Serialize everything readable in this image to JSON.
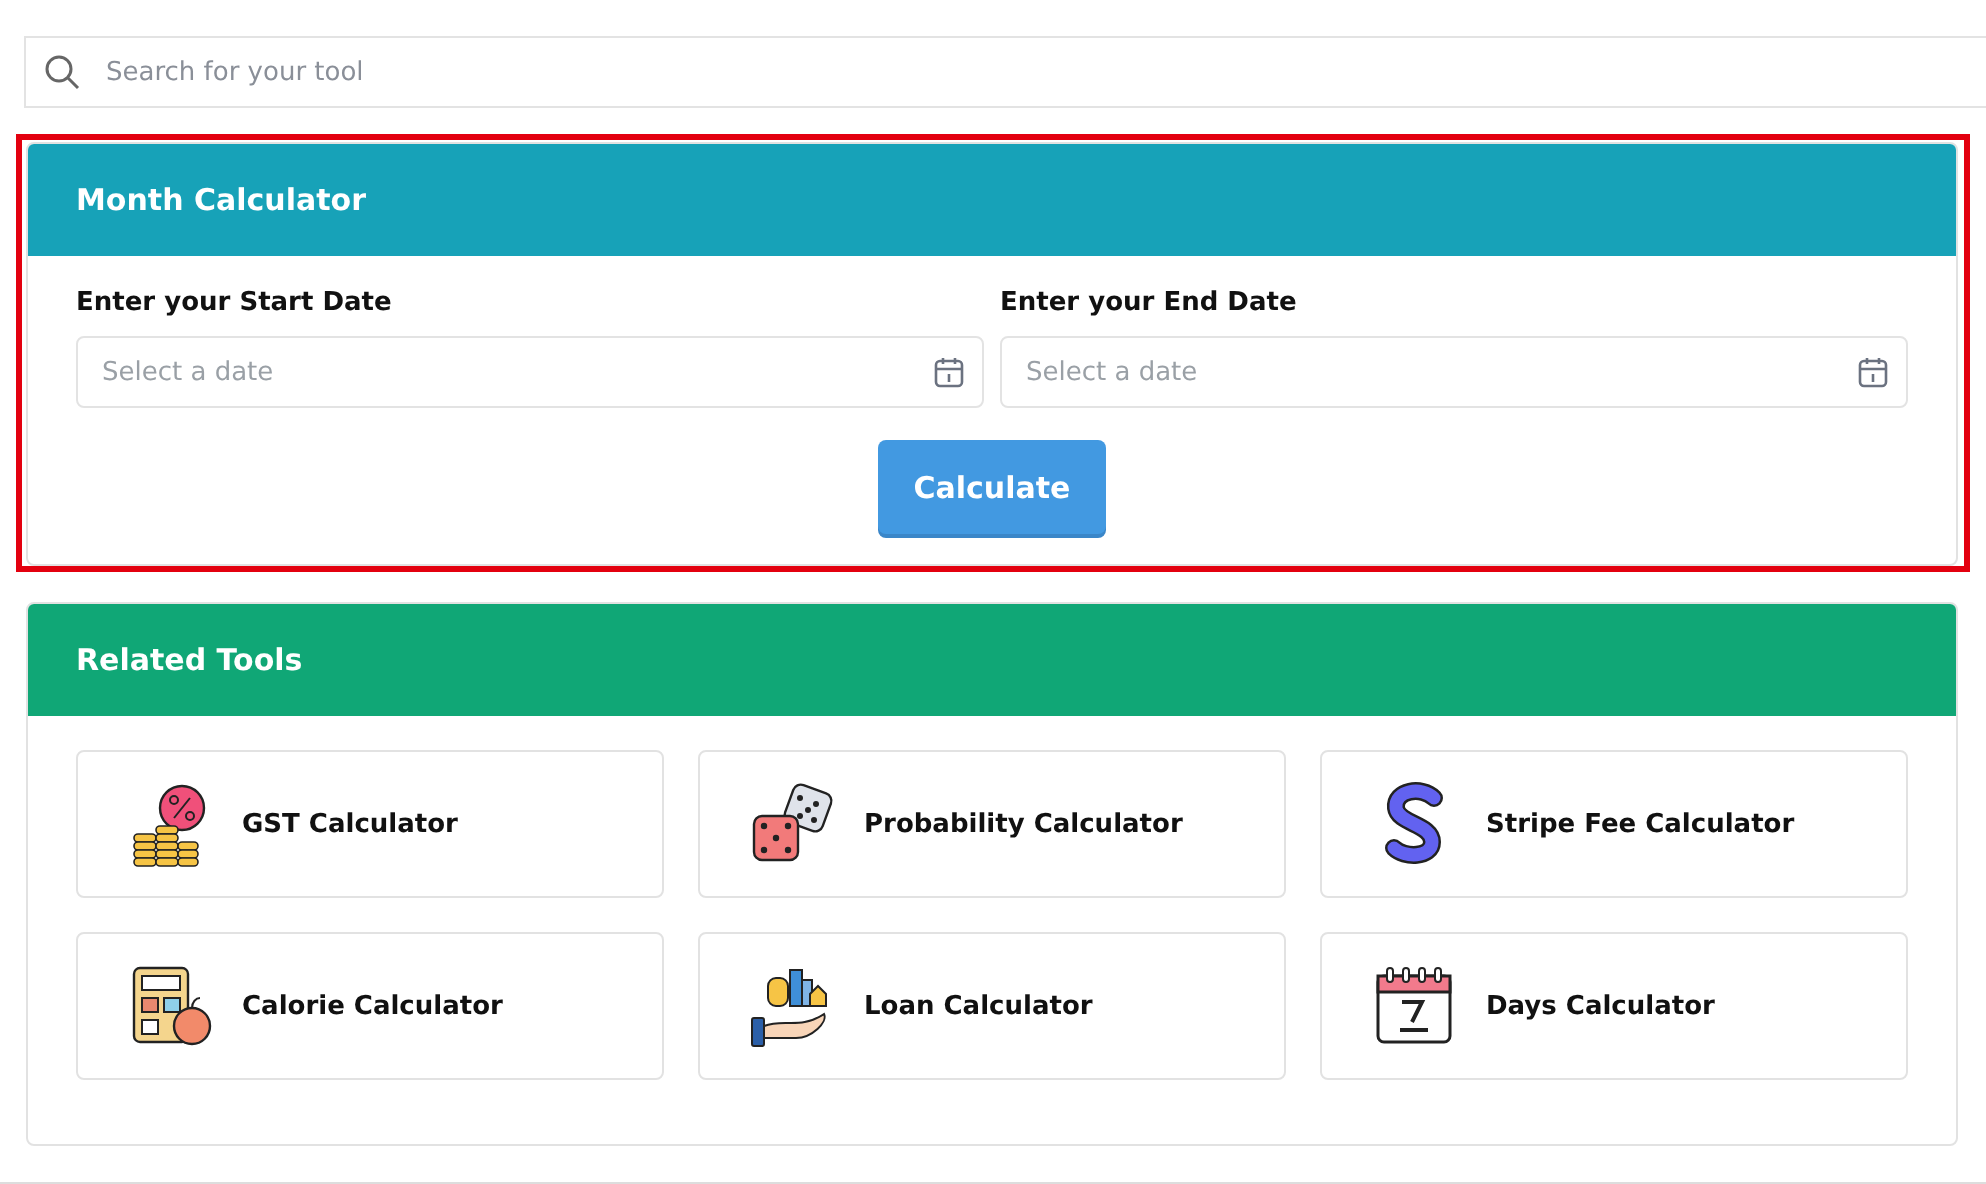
{
  "search": {
    "placeholder": "Search for your tool"
  },
  "calculator": {
    "title": "Month Calculator",
    "highlighted": true,
    "fields": [
      {
        "label": "Enter your Start Date",
        "placeholder": "Select a date"
      },
      {
        "label": "Enter your End Date",
        "placeholder": "Select a date"
      }
    ],
    "button": "Calculate"
  },
  "related": {
    "title": "Related Tools",
    "tools": [
      {
        "name": "GST Calculator",
        "kind": "coins"
      },
      {
        "name": "Probability Calculator",
        "kind": "dice"
      },
      {
        "name": "Stripe Fee Calculator",
        "kind": "squiggle"
      },
      {
        "name": "Calorie Calculator",
        "kind": "calculator"
      },
      {
        "name": "Loan Calculator",
        "kind": "hand"
      },
      {
        "name": "Days Calculator",
        "kind": "calendar"
      }
    ]
  }
}
